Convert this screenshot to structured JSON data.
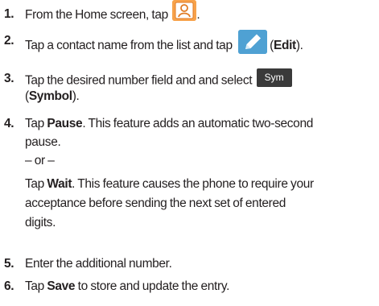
{
  "steps": [
    {
      "num": "1.",
      "text_before": "From the Home screen, tap ",
      "icon": "contacts-icon",
      "text_after": "."
    },
    {
      "num": "2.",
      "text_before": "Tap a contact name from the list and tap ",
      "icon": "edit-pencil-icon",
      "paren_open": "(",
      "bold": "Edit",
      "paren_close": ")."
    },
    {
      "num": "3.",
      "text_before": "Tap the desired number field and and select ",
      "icon": "sym-key-icon",
      "icon_label": "Sym",
      "line2_open": "(",
      "line2_bold": "Symbol",
      "line2_close": ")."
    },
    {
      "num": "4.",
      "pre": "Tap ",
      "bold": "Pause",
      "post": ". This feature adds an automatic two-second",
      "line2": "pause.",
      "or": "– or –",
      "alt_pre": "Tap ",
      "alt_bold": "Wait",
      "alt_post": ". This feature causes the phone to require your",
      "alt_line2": "acceptance before sending the next set of entered",
      "alt_line3": "digits."
    },
    {
      "num": "5.",
      "text": "Enter the additional number."
    },
    {
      "num": "6.",
      "pre": "Tap ",
      "bold": "Save",
      "post": " to store and update the entry."
    }
  ],
  "colors": {
    "text": "#231f20",
    "contacts_icon_bg": "#f7a24b",
    "edit_icon_bg": "#4fa1d3",
    "sym_icon_bg": "#3a3a3a"
  }
}
